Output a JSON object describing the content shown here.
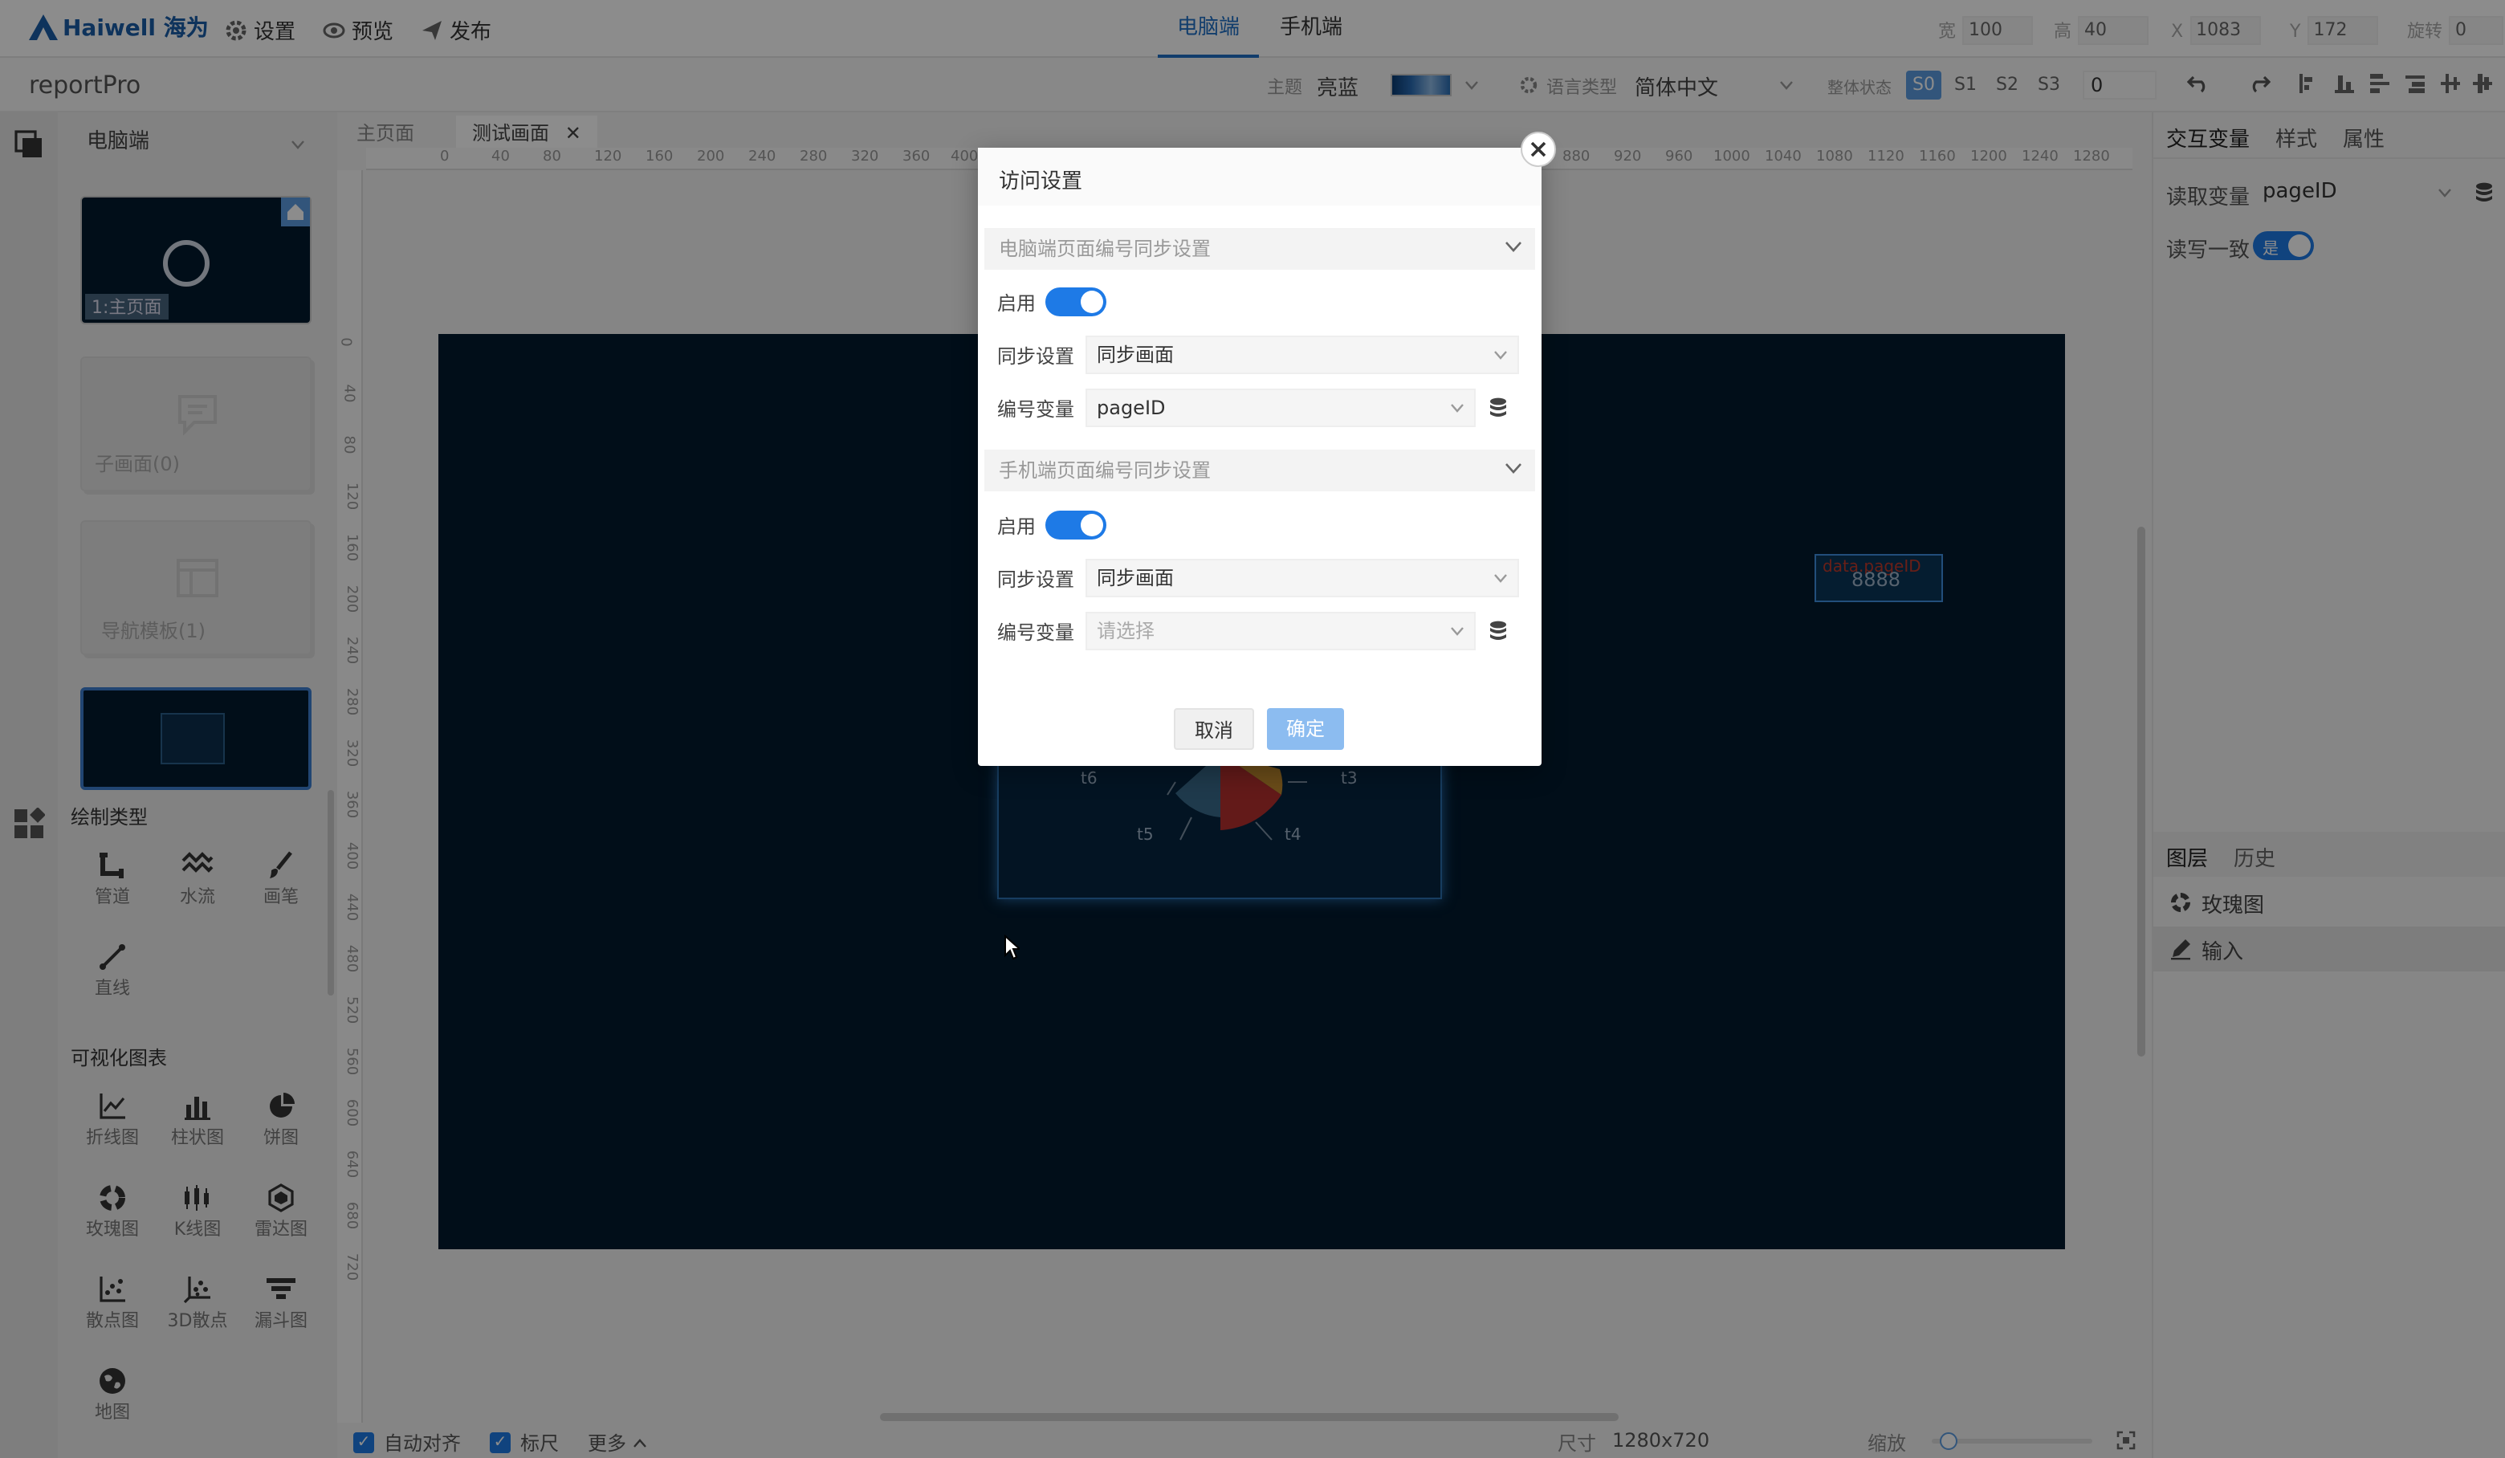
{
  "topbar": {
    "logo": "Haiwell 海为",
    "settings": "设置",
    "preview": "预览",
    "publish": "发布",
    "tabs": [
      "电脑端",
      "手机端"
    ],
    "geometry": {
      "w_label": "宽",
      "w": "100",
      "h_label": "高",
      "h": "40",
      "x_label": "X",
      "x": "1083",
      "y_label": "Y",
      "y": "172",
      "rot_label": "旋转",
      "rot": "0"
    }
  },
  "bar2": {
    "project": "reportPro",
    "theme_label": "主题",
    "theme_value": "亮蓝",
    "lang_label": "语言类型",
    "lang_value": "简体中文",
    "state_label": "整体状态",
    "states": [
      "S0",
      "S1",
      "S2",
      "S3"
    ],
    "state_num": "0"
  },
  "left": {
    "device": "电脑端",
    "pages": [
      "1:主页面",
      "子画面(0)",
      "导航模板(1)"
    ],
    "draw_title": "绘制类型",
    "draw_items": [
      "管道",
      "水流",
      "画笔",
      "直线"
    ],
    "viz_title": "可视化图表",
    "viz_items": [
      "折线图",
      "柱状图",
      "饼图",
      "玫瑰图",
      "K线图",
      "雷达图",
      "散点图",
      "3D散点",
      "漏斗图",
      "地图"
    ]
  },
  "canvas": {
    "tabs": [
      "主页面",
      "测试画面"
    ],
    "hruler": [
      "0",
      "40",
      "80",
      "120",
      "160",
      "200",
      "240",
      "280",
      "320",
      "360",
      "400",
      "880",
      "920",
      "960",
      "1000",
      "1040",
      "1080",
      "1120",
      "1160",
      "1200",
      "1240",
      "1280"
    ],
    "vruler": [
      "0",
      "40",
      "80",
      "120",
      "160",
      "200",
      "240",
      "280",
      "320",
      "360",
      "400",
      "440",
      "480",
      "520",
      "560",
      "600",
      "640",
      "680",
      "720"
    ],
    "selected_text": "8888",
    "selected_caption": "data.pageID",
    "rose_labels": [
      "t6",
      "t5",
      "t4",
      "t3"
    ]
  },
  "bottom": {
    "auto_align": "自动对齐",
    "ruler": "标尺",
    "more": "更多",
    "size_label": "尺寸",
    "size_value": "1280x720",
    "zoom_label": "缩放"
  },
  "right": {
    "tabs": [
      "交互变量",
      "样式",
      "属性"
    ],
    "read_var_label": "读取变量",
    "read_var_value": "pageID",
    "rw_label": "读写一致",
    "rw_value": "是",
    "layer_tabs": [
      "图层",
      "历史"
    ],
    "layers": [
      "玫瑰图",
      "输入"
    ]
  },
  "dialog": {
    "title": "访问设置",
    "pc_section": "电脑端页面编号同步设置",
    "mobile_section": "手机端页面编号同步设置",
    "enable_label": "启用",
    "sync_label": "同步设置",
    "sync_value": "同步画面",
    "var_label": "编号变量",
    "pc_var_value": "pageID",
    "mobile_var_placeholder": "请选择",
    "cancel": "取消",
    "ok": "确定"
  }
}
